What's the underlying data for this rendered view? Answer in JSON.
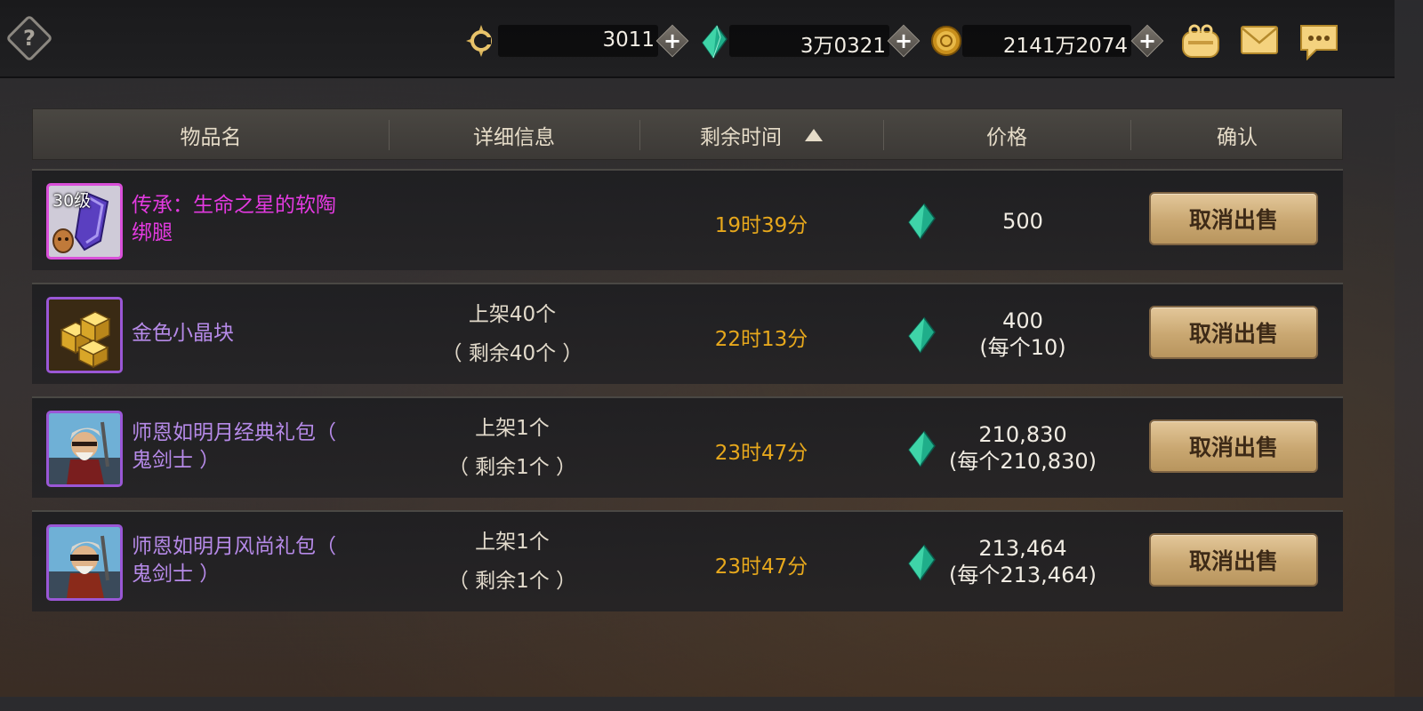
{
  "topbar": {
    "currencies": [
      {
        "name": "ceras",
        "icon": "ceras-coin-icon",
        "value": "3011"
      },
      {
        "name": "gem",
        "icon": "gem-icon",
        "value": "3万0321"
      },
      {
        "name": "gold",
        "icon": "gold-coin-icon",
        "value": "2141万2074"
      }
    ],
    "plus_label": "+",
    "help_label": "?"
  },
  "table": {
    "headers": [
      "物品名",
      "详细信息",
      "剩余时间",
      "价格",
      "确认"
    ],
    "sorted_column": "剩余时间",
    "sort_direction": "ascending",
    "rows": [
      {
        "level": "30级",
        "name": "传承：生命之星的软陶绑腿",
        "name_line1": "传承：生命之星的软陶",
        "name_line2": "绑腿",
        "detail_line1": "",
        "detail_line2": "",
        "time": "19时39分",
        "price": "500",
        "price_each": "",
        "button": "取消出售"
      },
      {
        "level": "",
        "name_line1": "金色小晶块",
        "name_line2": "",
        "detail_line1": "上架40个",
        "detail_line2": "（ 剩余40个 ）",
        "time": "22时13分",
        "price": "400",
        "price_each": "(每个10)",
        "button": "取消出售"
      },
      {
        "level": "",
        "name_line1": "师恩如明月经典礼包（",
        "name_line2": "鬼剑士 ）",
        "detail_line1": "上架1个",
        "detail_line2": "（ 剩余1个 ）",
        "time": "23时47分",
        "price": "210,830",
        "price_each": "(每个210,830)",
        "button": "取消出售"
      },
      {
        "level": "",
        "name_line1": "师恩如明月风尚礼包（",
        "name_line2": "鬼剑士 ）",
        "detail_line1": "上架1个",
        "detail_line2": "（ 剩余1个 ）",
        "time": "23时47分",
        "price": "213,464",
        "price_each": "(每个213,464)",
        "button": "取消出售"
      }
    ]
  },
  "colors": {
    "time": "#e7a81c",
    "name_legendary": "#e33ae0",
    "name_epic": "#b68ae8",
    "button": "#c9a771"
  }
}
